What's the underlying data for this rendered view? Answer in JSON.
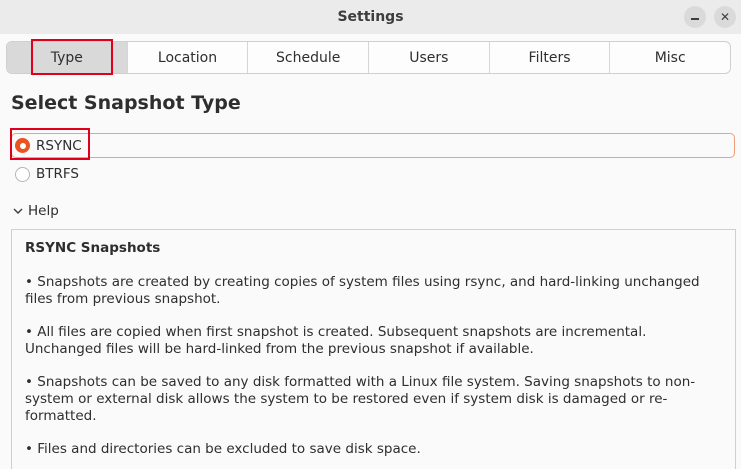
{
  "window": {
    "title": "Settings",
    "minimize_icon": "minimize-icon",
    "close_glyph": "✕"
  },
  "tabs": [
    {
      "label": "Type",
      "active": true
    },
    {
      "label": "Location"
    },
    {
      "label": "Schedule"
    },
    {
      "label": "Users"
    },
    {
      "label": "Filters"
    },
    {
      "label": "Misc"
    }
  ],
  "section": {
    "title": "Select Snapshot Type"
  },
  "options": {
    "rsync": {
      "label": "RSYNC",
      "selected": true
    },
    "btrfs": {
      "label": "BTRFS",
      "selected": false
    }
  },
  "help": {
    "toggle_label": "Help",
    "expanded": true,
    "heading": "RSYNC Snapshots",
    "paragraphs": [
      "• Snapshots are created by creating copies of system files using rsync, and hard-linking unchanged files from previous snapshot.",
      "• All files are copied when first snapshot is created. Subsequent snapshots are incremental. Unchanged files will be hard-linked from the previous snapshot if available.",
      "• Snapshots can be saved to any disk formatted with a Linux file system. Saving snapshots to non-system or external disk allows the system to be restored even if system disk is damaged or re-formatted.",
      "• Files and directories can be excluded to save disk space."
    ]
  },
  "colors": {
    "accent": "#e95420",
    "highlight": "#e0001b"
  }
}
